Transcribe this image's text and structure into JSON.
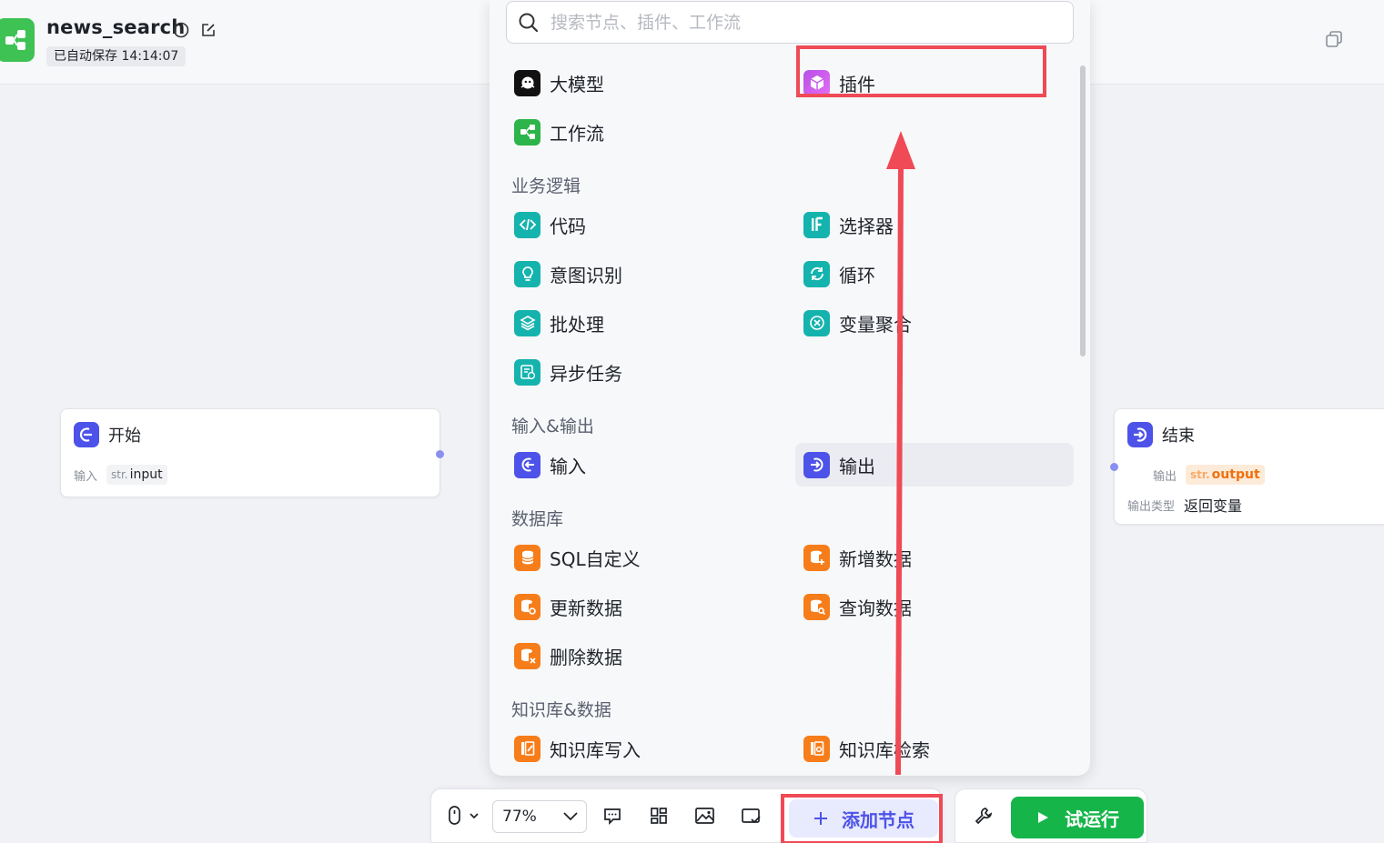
{
  "header": {
    "title": "news_search",
    "autosave": "已自动保存 14:14:07"
  },
  "search": {
    "placeholder": "搜索节点、插件、工作流"
  },
  "menu": {
    "top": [
      {
        "label": "大模型",
        "icon": "llm-icon"
      },
      {
        "label": "插件",
        "icon": "plugin-icon"
      },
      {
        "label": "工作流",
        "icon": "workflow-icon"
      }
    ],
    "sections": [
      {
        "title": "业务逻辑",
        "items": [
          "代码",
          "选择器",
          "意图识别",
          "循环",
          "批处理",
          "变量聚合",
          "异步任务"
        ]
      },
      {
        "title": "输入&输出",
        "items": [
          "输入",
          "输出"
        ]
      },
      {
        "title": "数据库",
        "items": [
          "SQL自定义",
          "新增数据",
          "更新数据",
          "查询数据",
          "删除数据"
        ]
      },
      {
        "title": "知识库&数据",
        "items": [
          "知识库写入",
          "知识库检索"
        ]
      }
    ]
  },
  "nodes": {
    "start": {
      "title": "开始",
      "input_label": "输入",
      "input_type": "str.",
      "input_name": "input"
    },
    "end": {
      "title": "结束",
      "output_label": "输出",
      "output_type": "str.",
      "output_name": "output",
      "output_kind_label": "输出类型",
      "output_kind": "返回变量"
    }
  },
  "toolbar": {
    "zoom": "77%",
    "add_node": "添加节点",
    "run": "试运行"
  },
  "colors": {
    "accent": "#4d53e8",
    "run_green": "#16b54a",
    "annotation_red": "#ef4a55"
  }
}
